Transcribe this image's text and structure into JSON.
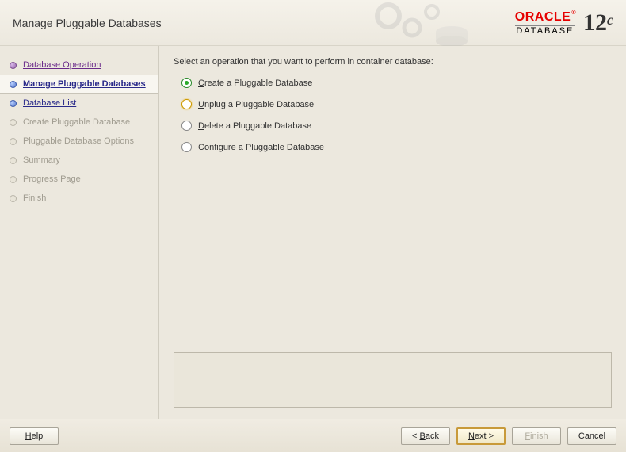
{
  "header": {
    "title": "Manage Pluggable Databases",
    "brand": "ORACLE",
    "product": "DATABASE",
    "version_major": "12",
    "version_suffix": "c"
  },
  "sidebar": {
    "items": [
      {
        "label": "Database Operation",
        "state": "done"
      },
      {
        "label": "Manage Pluggable Databases",
        "state": "active"
      },
      {
        "label": "Database List",
        "state": "upcoming"
      },
      {
        "label": "Create Pluggable Database",
        "state": "disabled"
      },
      {
        "label": "Pluggable Database Options",
        "state": "disabled"
      },
      {
        "label": "Summary",
        "state": "disabled"
      },
      {
        "label": "Progress Page",
        "state": "disabled"
      },
      {
        "label": "Finish",
        "state": "disabled"
      }
    ]
  },
  "main": {
    "prompt": "Select an operation that you want to perform in container database:",
    "options": [
      {
        "mn": "C",
        "rest": "reate a Pluggable Database",
        "selected": true
      },
      {
        "mn": "U",
        "rest": "nplug a Pluggable Database",
        "selected": false,
        "hover": true
      },
      {
        "mn": "D",
        "rest": "elete a Pluggable Database",
        "selected": false
      },
      {
        "mn": "",
        "rest": "Configure a Pluggable Database",
        "mn2": "o",
        "pre": "C",
        "selected": false
      }
    ]
  },
  "footer": {
    "help_mn": "H",
    "help_rest": "elp",
    "back_pre": "< ",
    "back_mn": "B",
    "back_rest": "ack",
    "next_mn": "N",
    "next_rest": "ext >",
    "finish_mn": "F",
    "finish_rest": "inish",
    "cancel": "Cancel"
  }
}
